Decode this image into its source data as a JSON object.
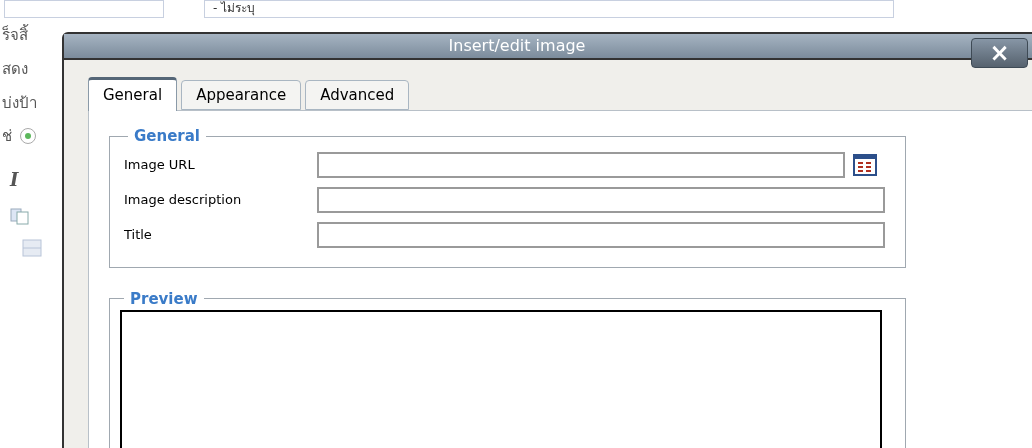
{
  "background_page": {
    "top_field_value": "- ไม่ระบุ",
    "lines": [
      "ร็จสิ้",
      "สดง",
      "บ่งป้า",
      "ช่"
    ],
    "radio": {
      "selected": true
    },
    "toolbar_italic": "I"
  },
  "dialog": {
    "title": "Insert/edit image",
    "close": "×",
    "tabs": [
      {
        "label": "General",
        "selected": true
      },
      {
        "label": "Appearance",
        "selected": false
      },
      {
        "label": "Advanced",
        "selected": false
      }
    ],
    "general": {
      "legend": "General",
      "fields": [
        {
          "label": "Image URL",
          "kind": "browse"
        },
        {
          "label": "Image description",
          "kind": "text"
        },
        {
          "label": "Title",
          "kind": "text"
        }
      ]
    },
    "preview": {
      "legend": "Preview"
    }
  }
}
